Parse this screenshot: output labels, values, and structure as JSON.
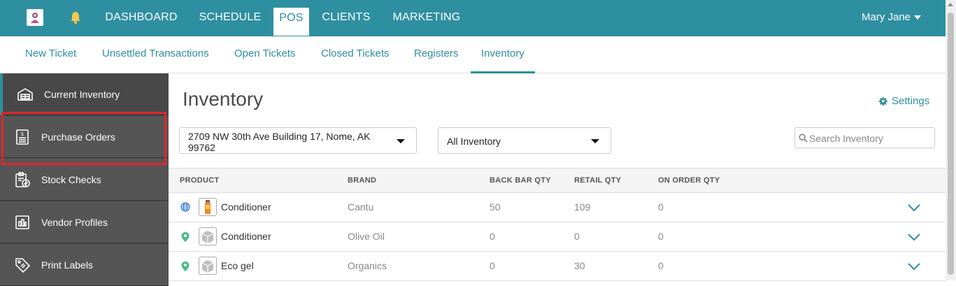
{
  "topnav": {
    "items": [
      {
        "label": "DASHBOARD"
      },
      {
        "label": "SCHEDULE"
      },
      {
        "label": "POS",
        "active": true
      },
      {
        "label": "CLIENTS"
      },
      {
        "label": "MARKETING"
      }
    ],
    "user": "Mary Jane",
    "accent": "#2e8fa0"
  },
  "subnav": {
    "items": [
      {
        "label": "New Ticket"
      },
      {
        "label": "Unsettled Transactions"
      },
      {
        "label": "Open Tickets"
      },
      {
        "label": "Closed Tickets"
      },
      {
        "label": "Registers"
      },
      {
        "label": "Inventory",
        "active": true
      }
    ]
  },
  "sidebar": {
    "items": [
      {
        "label": "Current Inventory",
        "icon": "warehouse-icon",
        "active": true
      },
      {
        "label": "Purchase Orders",
        "icon": "purchase-order-icon"
      },
      {
        "label": "Stock Checks",
        "icon": "clipboard-check-icon"
      },
      {
        "label": "Vendor Profiles",
        "icon": "vendor-icon"
      },
      {
        "label": "Print Labels",
        "icon": "tag-icon"
      }
    ],
    "highlight_color": "#e0252a"
  },
  "main": {
    "title": "Inventory",
    "settings_label": "Settings",
    "location_select": "2709 NW 30th Ave Building 17, Nome, AK 99762",
    "inventory_select": "All Inventory",
    "search_placeholder": "Search Inventory"
  },
  "table": {
    "headers": {
      "product": "PRODUCT",
      "brand": "BRAND",
      "back_bar": "BACK BAR QTY",
      "retail": "RETAIL QTY",
      "on_order": "ON ORDER QTY"
    },
    "rows": [
      {
        "name": "Conditioner",
        "brand": "Cantu",
        "back_bar": "50",
        "retail": "109",
        "on_order": "0",
        "location_icon": "globe-icon",
        "thumb": "product-bottle-image"
      },
      {
        "name": "Conditioner",
        "brand": "Olive Oil",
        "back_bar": "0",
        "retail": "0",
        "on_order": "0",
        "location_icon": "map-pin-icon",
        "thumb": "box-icon"
      },
      {
        "name": "Eco gel",
        "brand": "Organics",
        "back_bar": "0",
        "retail": "30",
        "on_order": "0",
        "location_icon": "map-pin-icon",
        "thumb": "box-icon"
      }
    ]
  }
}
